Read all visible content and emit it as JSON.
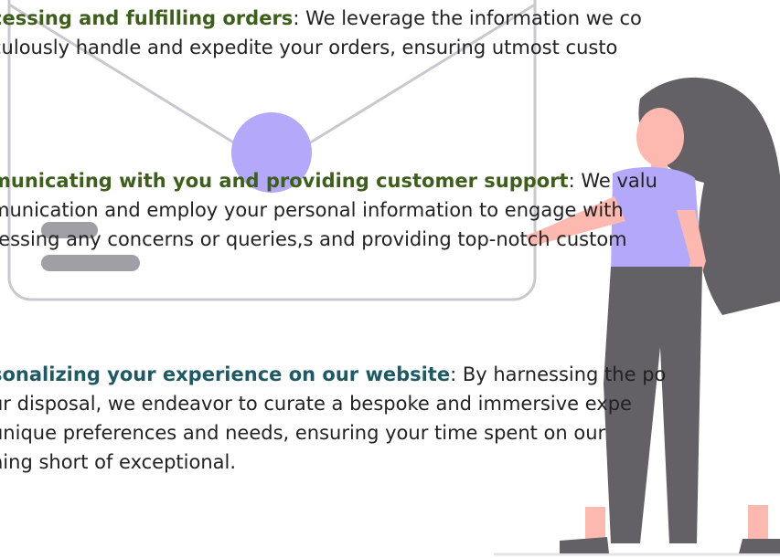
{
  "sections": [
    {
      "heading": "cessing and fulfilling orders",
      "lines": [
        ": We leverage the information we co",
        "culously handle and expedite your orders, ensuring utmost custo"
      ]
    },
    {
      "heading": "municating with you and providing customer support",
      "lines": [
        ": We valu",
        "munication and employ your personal information to engage with",
        "ressing any concerns or queries,s and providing top-notch custom"
      ]
    },
    {
      "heading": "sonalizing your experience on our website",
      "lines": [
        ": By harnessing the po",
        "ur disposal, we endeavor to curate a bespoke and immersive expe",
        " unique preferences and needs, ensuring your time spent on our",
        "hing short of exceptional."
      ]
    }
  ],
  "colors": {
    "heading_green": "#3e5f1b",
    "heading_teal": "#1e5a64",
    "accent_purple": "#b3a8fa",
    "hair": "#636066",
    "skin": "#fdb8b0",
    "frame_gray": "#c9c8cf",
    "bar_gray": "#a09fa6",
    "ground": "#e3e3e6"
  },
  "icons": {
    "envelope": "envelope-frame-illustration",
    "person": "woman-standing-illustration"
  }
}
